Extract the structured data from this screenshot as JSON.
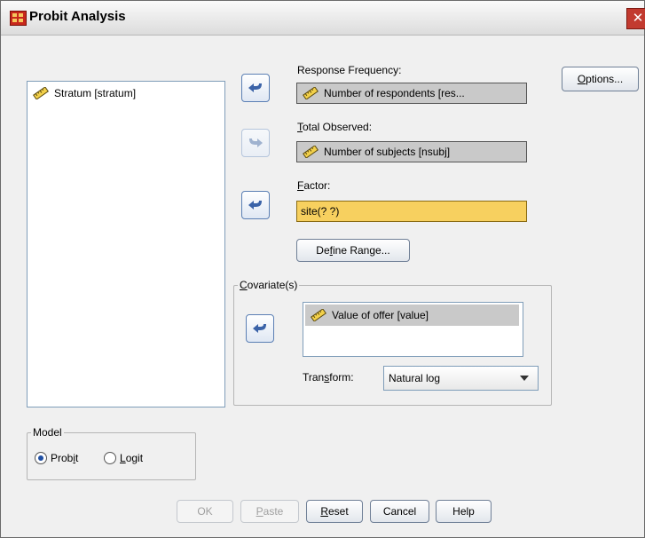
{
  "window": {
    "title": "Probit Analysis"
  },
  "source_list": {
    "items": [
      {
        "label": "Stratum [stratum]",
        "icon": "ruler-icon"
      }
    ]
  },
  "response_frequency": {
    "label": "Response Frequency:",
    "value": "Number of respondents [res..."
  },
  "total_observed": {
    "label_pre": "",
    "label_u": "T",
    "label_post": "otal Observed:",
    "value": "Number of subjects [nsubj]"
  },
  "factor": {
    "label_u": "F",
    "label_post": "actor:",
    "value": "site(? ?)"
  },
  "define_range": {
    "pre": "De",
    "u": "f",
    "post": "ine Range..."
  },
  "options": {
    "u": "O",
    "post": "ptions..."
  },
  "covariates": {
    "title_u": "C",
    "title_post": "ovariate(s)",
    "items": [
      {
        "label": "Value of offer [value]"
      }
    ],
    "transform_pre": "Tran",
    "transform_u": "s",
    "transform_post": "form:",
    "transform_value": "Natural log"
  },
  "model": {
    "title": "Model",
    "probit": {
      "pre": "Prob",
      "u": "i",
      "post": "t",
      "selected": true
    },
    "logit": {
      "pre": "",
      "u": "L",
      "post": "ogit",
      "selected": false
    }
  },
  "buttons": {
    "ok": "OK",
    "paste_u": "P",
    "paste_post": "aste",
    "reset_u": "R",
    "reset_post": "eset",
    "cancel": "Cancel",
    "help": "Help"
  },
  "colors": {
    "accent": "#3b63a8",
    "target_filled": "#c9c9c9",
    "target_active": "#f7d05f",
    "title_icon": "#c8281c"
  }
}
